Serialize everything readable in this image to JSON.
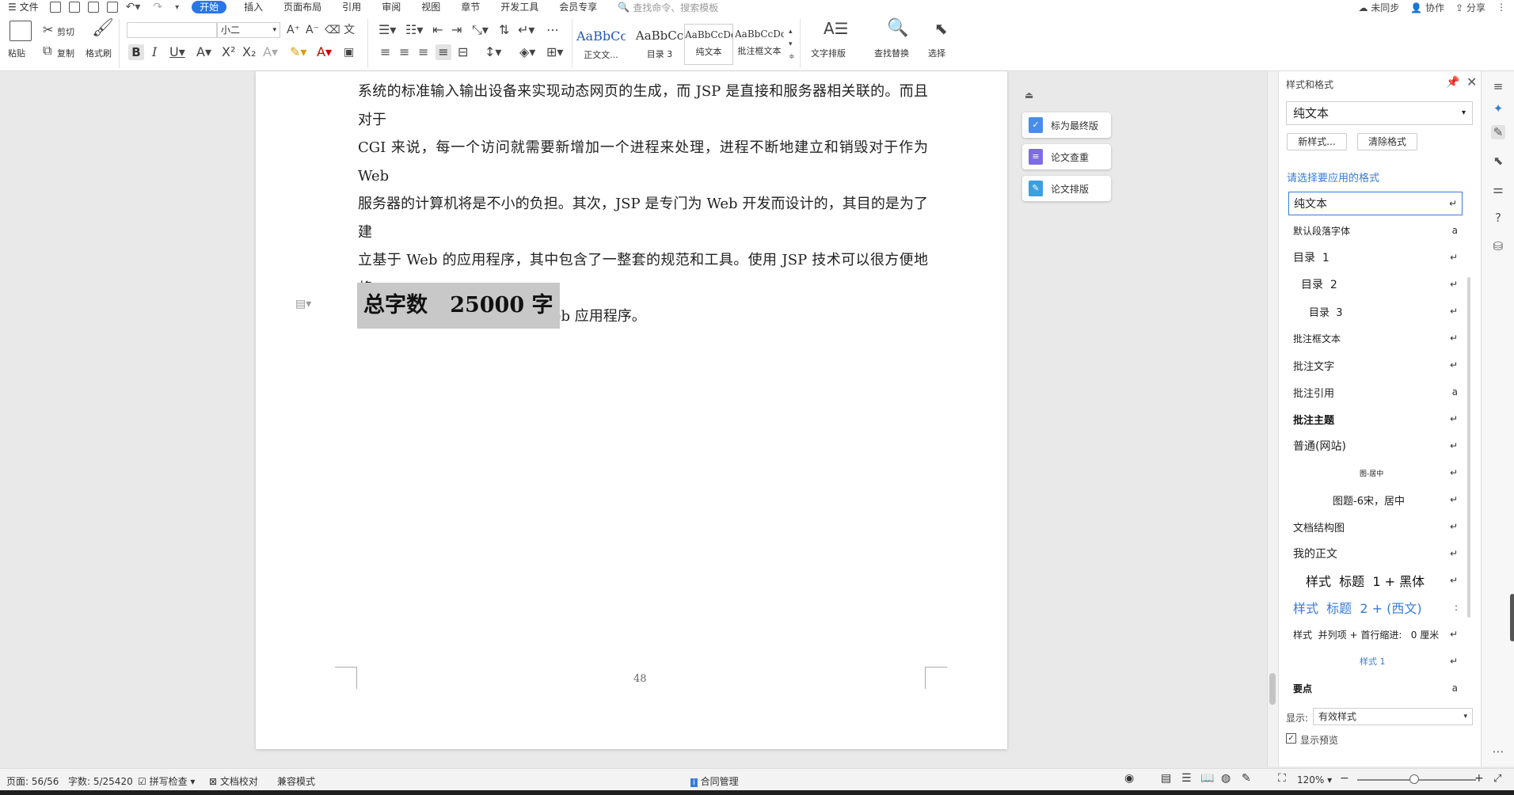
{
  "menu": {
    "file_label": "文件",
    "tabs": [
      {
        "label": "开始",
        "active": true
      },
      {
        "label": "插入",
        "active": false
      },
      {
        "label": "页面布局",
        "active": false
      },
      {
        "label": "引用",
        "active": false
      },
      {
        "label": "审阅",
        "active": false
      },
      {
        "label": "视图",
        "active": false
      },
      {
        "label": "章节",
        "active": false
      },
      {
        "label": "开发工具",
        "active": false
      },
      {
        "label": "会员专享",
        "active": false
      }
    ],
    "search_placeholder": "查找命令、搜索模板",
    "right": {
      "sync": "未同步",
      "collab": "协作",
      "share": "分享"
    }
  },
  "ribbon": {
    "paste": "粘贴",
    "cut": "剪切",
    "copy": "复制",
    "format_painter": "格式刷",
    "font_size": "小二",
    "font_name": "",
    "styles": [
      {
        "sample": "AaBbCcI",
        "name": "正文文...",
        "color": "#2457b8"
      },
      {
        "sample": "AaBbCc",
        "name": "目录 3",
        "color": "#222222"
      },
      {
        "sample": "AaBbCcDd",
        "name": "纯文本",
        "color": "#222222"
      },
      {
        "sample": "AaBbCcDd",
        "name": "批注框文本",
        "color": "#222222"
      }
    ],
    "text_layout": "文字排版",
    "find_replace": "查找替换",
    "select": "选择"
  },
  "document": {
    "paragraph_lines": [
      "系统的标准输入输出设备来实现动态网页的生成，而 JSP 是直接和服务器相关联的。而且对于",
      "CGI 来说，每一个访问就需要新增加一个进程来处理，进程不断地建立和销毁对于作为 Web",
      "服务器的计算机将是不小的负担。其次，JSP 是专门为 Web 开发而设计的，其目的是为了建",
      "立基于 Web 的应用程序，其中包含了一整套的规范和工具。使用 JSP 技术可以很方便地将一",
      "大堆 JSP 页面组合成为一个 Web 应用程序。"
    ],
    "word_count_text": "总字数   25000 字",
    "page_number": "48"
  },
  "float_tools": [
    {
      "label": "标为最终版"
    },
    {
      "label": "论文查重"
    },
    {
      "label": "论文排版"
    }
  ],
  "panel": {
    "title": "样式和格式",
    "current_style": "纯文本",
    "new_style_btn": "新样式...",
    "clear_format_btn": "清除格式",
    "choose_label": "请选择要应用的格式",
    "styles": [
      {
        "name": "纯文本",
        "mark": "↵",
        "indent": 0,
        "size": 14,
        "bold": false,
        "color": "#222222",
        "selected": true
      },
      {
        "name": "默认段落字体",
        "mark": "a",
        "indent": 0,
        "size": 12,
        "bold": false,
        "color": "#222222",
        "selected": false
      },
      {
        "name": "目录  1",
        "mark": "↵",
        "indent": 0,
        "size": 14,
        "bold": false,
        "color": "#222222",
        "selected": false
      },
      {
        "name": "目录  2",
        "mark": "↵",
        "indent": 10,
        "size": 14,
        "bold": false,
        "color": "#222222",
        "selected": false
      },
      {
        "name": "目录  3",
        "mark": "↵",
        "indent": 20,
        "size": 13,
        "bold": false,
        "color": "#222222",
        "selected": false
      },
      {
        "name": "批注框文本",
        "mark": "↵",
        "indent": 0,
        "size": 12,
        "bold": false,
        "color": "#222222",
        "selected": false
      },
      {
        "name": "批注文字",
        "mark": "↵",
        "indent": 0,
        "size": 13,
        "bold": false,
        "color": "#222222",
        "selected": false
      },
      {
        "name": "批注引用",
        "mark": "a",
        "indent": 0,
        "size": 13,
        "bold": false,
        "color": "#222222",
        "selected": false
      },
      {
        "name": "批注主题",
        "mark": "↵",
        "indent": 0,
        "size": 13,
        "bold": true,
        "color": "#111111",
        "selected": false
      },
      {
        "name": "普通(网站)",
        "mark": "↵",
        "indent": 0,
        "size": 14,
        "bold": false,
        "color": "#222222",
        "selected": false
      },
      {
        "name": "图-居中",
        "mark": "↵",
        "indent": 84,
        "size": 9,
        "bold": false,
        "color": "#222222",
        "selected": false
      },
      {
        "name": "图题-6宋，居中",
        "mark": "↵",
        "indent": 50,
        "size": 13,
        "bold": false,
        "color": "#222222",
        "selected": false
      },
      {
        "name": "文档结构图",
        "mark": "↵",
        "indent": 0,
        "size": 13,
        "bold": false,
        "color": "#222222",
        "selected": false
      },
      {
        "name": "我的正文",
        "mark": "↵",
        "indent": 0,
        "size": 14,
        "bold": false,
        "color": "#222222",
        "selected": false
      },
      {
        "name": "样式  标题  1 + 黑体",
        "mark": "↵",
        "indent": 16,
        "size": 16,
        "bold": false,
        "color": "#111111",
        "selected": false
      },
      {
        "name": "样式  标题  2 + (西文)",
        "mark": ":",
        "indent": 0,
        "size": 16,
        "bold": false,
        "color": "#3a7bd5",
        "selected": false
      },
      {
        "name": "样式  并列项 + 首行缩进:   0 厘米",
        "mark": "↵",
        "indent": 0,
        "size": 12,
        "bold": false,
        "color": "#222222",
        "selected": false
      },
      {
        "name": "样式 1",
        "mark": "↵",
        "indent": 84,
        "size": 11,
        "bold": false,
        "color": "#3a7bd5",
        "selected": false
      },
      {
        "name": "要点",
        "mark": "a",
        "indent": 0,
        "size": 12,
        "bold": true,
        "color": "#111111",
        "selected": false
      }
    ],
    "display_label": "显示:",
    "display_value": "有效样式",
    "preview_label": "显示预览"
  },
  "status": {
    "page": "页面: 56/56",
    "words": "字数: 5/25420",
    "spell": "拼写检查",
    "proof": "文档校对",
    "compat": "兼容模式",
    "contract": "合同管理",
    "zoom": "120%"
  }
}
